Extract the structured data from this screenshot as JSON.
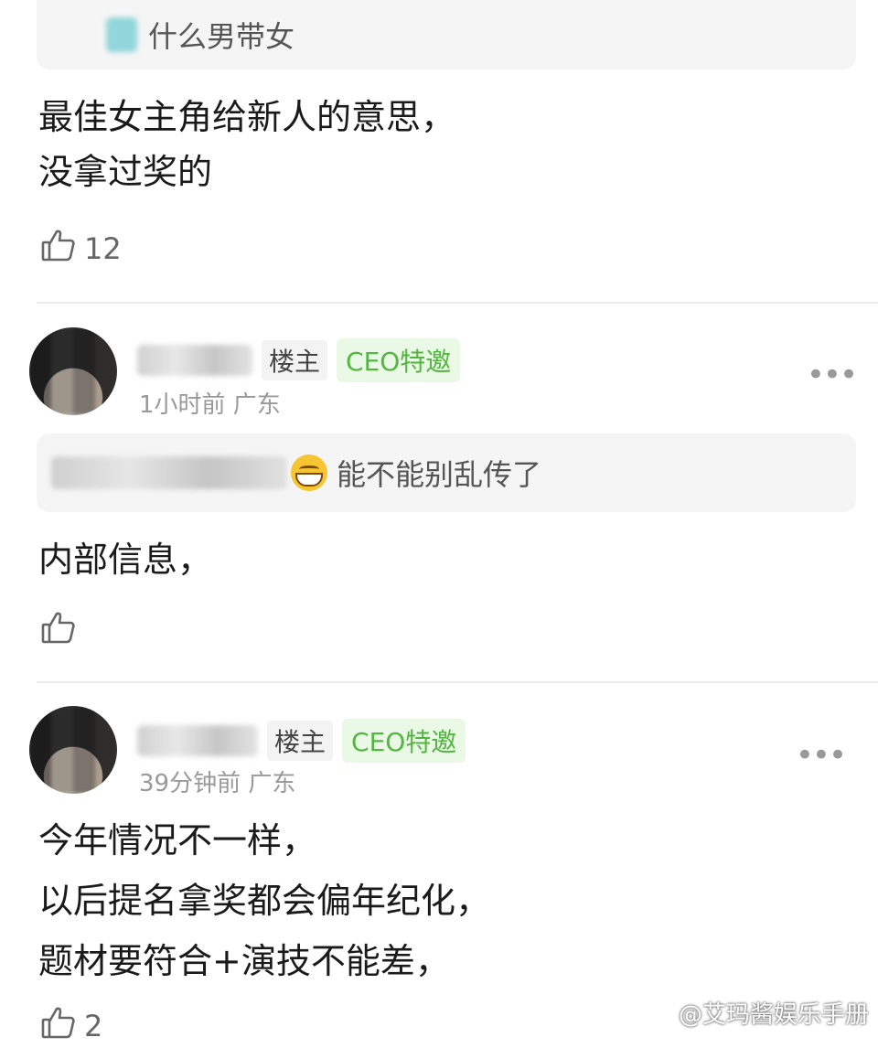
{
  "comment_1": {
    "quote_text": "什么男带女",
    "body_lines": [
      "最佳女主角给新人的意思，",
      "没拿过奖的"
    ],
    "like_count": "12"
  },
  "comment_2": {
    "tag_owner": "楼主",
    "tag_ceo": "CEO特邀",
    "meta": "1小时前 广东",
    "more": "•••",
    "quote_text": "能不能别乱传了",
    "body_lines": [
      "内部信息，"
    ],
    "like_count": ""
  },
  "comment_3": {
    "tag_owner": "楼主",
    "tag_ceo": "CEO特邀",
    "meta": "39分钟前 广东",
    "more": "•••",
    "body_lines": [
      "今年情况不一样，",
      "以后提名拿奖都会偏年纪化，",
      "题材要符合+演技不能差，"
    ],
    "like_count": "2"
  },
  "watermark": "@艾玛酱娱乐手册",
  "colors": {
    "ceo_green": "#52b640",
    "quote_bg": "#f5f5f5",
    "divider": "#ececec"
  }
}
